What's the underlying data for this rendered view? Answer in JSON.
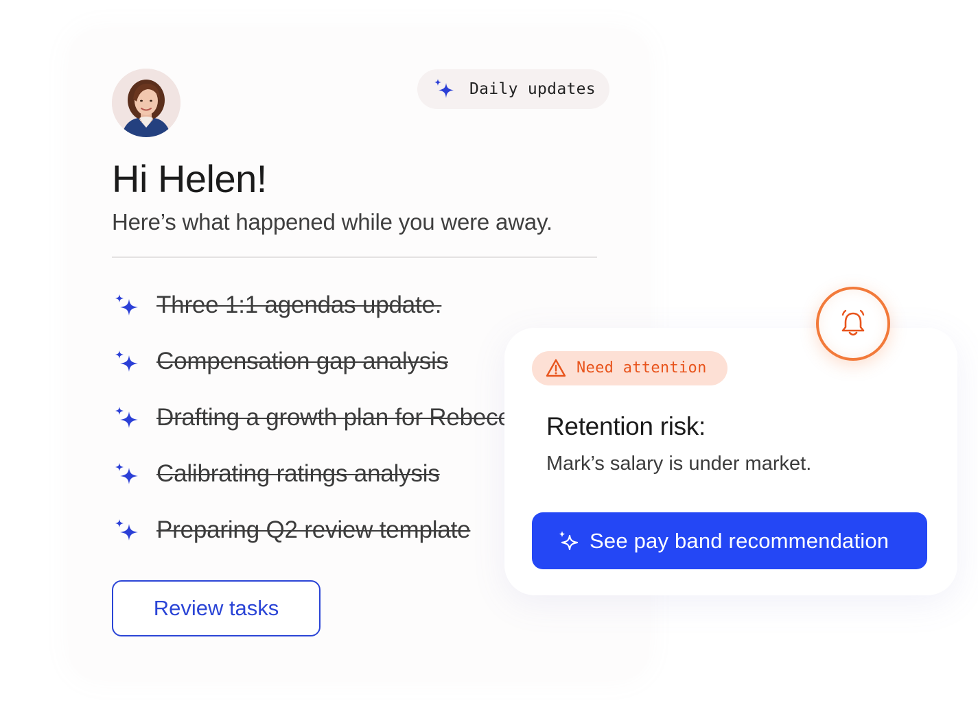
{
  "header": {
    "avatar_alt": "Helen",
    "daily_pill": {
      "label": "Daily updates",
      "icon": "sparkle-icon"
    }
  },
  "greeting": {
    "title": "Hi Helen!",
    "subtitle": "Here’s what happened while you were away."
  },
  "tasks": [
    {
      "label": "Three 1:1 agendas update.",
      "done": true
    },
    {
      "label": "Compensation gap analysis",
      "done": true
    },
    {
      "label": "Drafting a growth plan for Rebecca",
      "done": true
    },
    {
      "label": "Calibrating ratings analysis",
      "done": true
    },
    {
      "label": "Preparing Q2 review template",
      "done": true
    }
  ],
  "review_button": {
    "label": "Review tasks"
  },
  "attention": {
    "badge": {
      "label": "Need attention",
      "icon": "warning-icon"
    },
    "title": "Retention risk:",
    "description": "Mark’s salary is under market.",
    "cta": {
      "label": "See pay band recommendation",
      "icon": "sparkle-icon"
    },
    "bell_icon": "bell-icon"
  },
  "colors": {
    "accent": "#2447f5",
    "sparkle": "#2b3fd6",
    "warning": "#e8541c",
    "warning_bg": "#fde0d5"
  }
}
